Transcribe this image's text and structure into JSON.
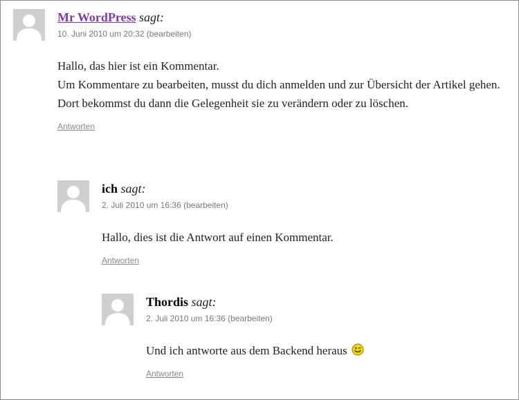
{
  "comments": [
    {
      "author": "Mr WordPress",
      "says": "sagt:",
      "date": "10. Juni 2010 um 20:32",
      "edit_label": "(bearbeiten)",
      "paragraphs": [
        "Hallo, das hier ist ein Kommentar.",
        "Um Kommentare zu bearbeiten, musst du dich anmelden und zur Übersicht der Artikel gehen. Dort bekommst du dann die Gelegenheit sie zu verändern oder zu löschen."
      ],
      "reply_label": "Antworten"
    },
    {
      "author": "ich",
      "says": "sagt:",
      "date": "2. Juli 2010 um 16:36",
      "edit_label": "(bearbeiten)",
      "paragraphs": [
        "Hallo, dies ist die Antwort auf einen Kommentar."
      ],
      "reply_label": "Antworten"
    },
    {
      "author": "Thordis",
      "says": "sagt:",
      "date": "2. Juli 2010 um 16:36",
      "edit_label": "(bearbeiten)",
      "paragraphs": [
        "Und ich antworte aus dem Backend heraus"
      ],
      "emoticon": "smiley-icon",
      "reply_label": "Antworten"
    }
  ],
  "colors": {
    "author_link": "#7b3ea3",
    "meta_text": "#777777",
    "avatar_bg": "#cfcfcf",
    "smiley": "#f5d800"
  }
}
